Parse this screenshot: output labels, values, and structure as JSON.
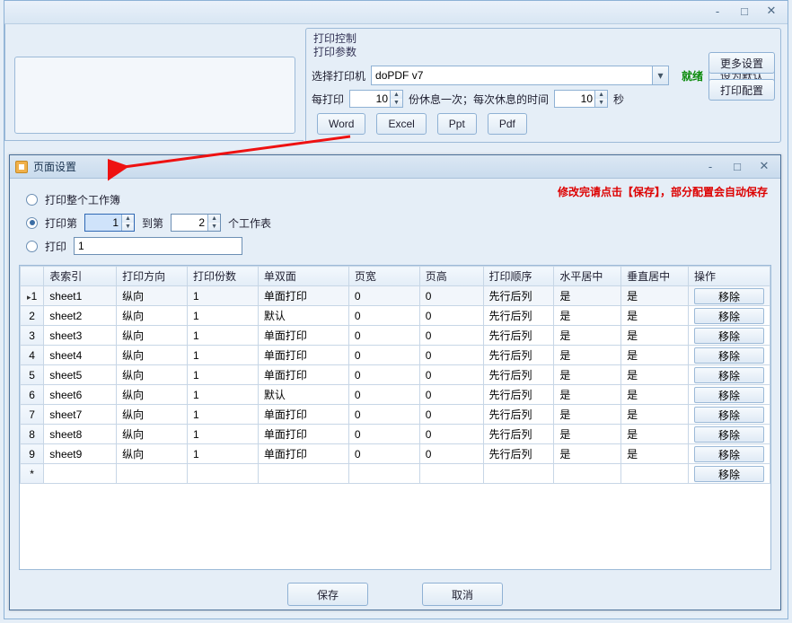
{
  "outer": {
    "groupTitle": "打印控制",
    "paramTitle": "打印参数",
    "selectPrinter": "选择打印机",
    "printerValue": "doPDF v7",
    "status": "就绪",
    "setDefault": "设为默认",
    "eachPrint": "每打印",
    "eachPrintValue": "10",
    "restOnce": "份休息一次；每次休息的时间",
    "restTimeValue": "10",
    "seconds": "秒",
    "moreSettings": "更多设置",
    "printConfig": "打印配置",
    "fmtWord": "Word",
    "fmtExcel": "Excel",
    "fmtPpt": "Ppt",
    "fmtPdf": "Pdf"
  },
  "dialog": {
    "title": "页面设置",
    "opt1": "打印整个工作簿",
    "opt2a": "打印第",
    "opt2b": "到第",
    "opt2c": "个工作表",
    "fromValue": "1",
    "toValue": "2",
    "opt3": "打印",
    "opt3Value": "1",
    "redNote": "修改完请点击【保存】，部分配置会自动保存",
    "save": "保存",
    "cancel": "取消"
  },
  "grid": {
    "headers": [
      "",
      "表索引",
      "打印方向",
      "打印份数",
      "单双面",
      "页宽",
      "页高",
      "打印顺序",
      "水平居中",
      "垂直居中",
      "操作"
    ],
    "removeLabel": "移除",
    "rows": [
      {
        "n": "1",
        "idx": "sheet1",
        "dir": "纵向",
        "copies": "1",
        "side": "单面打印",
        "w": "0",
        "h": "0",
        "order": "先行后列",
        "hc": "是",
        "vc": "是"
      },
      {
        "n": "2",
        "idx": "sheet2",
        "dir": "纵向",
        "copies": "1",
        "side": "默认",
        "w": "0",
        "h": "0",
        "order": "先行后列",
        "hc": "是",
        "vc": "是"
      },
      {
        "n": "3",
        "idx": "sheet3",
        "dir": "纵向",
        "copies": "1",
        "side": "单面打印",
        "w": "0",
        "h": "0",
        "order": "先行后列",
        "hc": "是",
        "vc": "是"
      },
      {
        "n": "4",
        "idx": "sheet4",
        "dir": "纵向",
        "copies": "1",
        "side": "单面打印",
        "w": "0",
        "h": "0",
        "order": "先行后列",
        "hc": "是",
        "vc": "是"
      },
      {
        "n": "5",
        "idx": "sheet5",
        "dir": "纵向",
        "copies": "1",
        "side": "单面打印",
        "w": "0",
        "h": "0",
        "order": "先行后列",
        "hc": "是",
        "vc": "是"
      },
      {
        "n": "6",
        "idx": "sheet6",
        "dir": "纵向",
        "copies": "1",
        "side": "默认",
        "w": "0",
        "h": "0",
        "order": "先行后列",
        "hc": "是",
        "vc": "是"
      },
      {
        "n": "7",
        "idx": "sheet7",
        "dir": "纵向",
        "copies": "1",
        "side": "单面打印",
        "w": "0",
        "h": "0",
        "order": "先行后列",
        "hc": "是",
        "vc": "是"
      },
      {
        "n": "8",
        "idx": "sheet8",
        "dir": "纵向",
        "copies": "1",
        "side": "单面打印",
        "w": "0",
        "h": "0",
        "order": "先行后列",
        "hc": "是",
        "vc": "是"
      },
      {
        "n": "9",
        "idx": "sheet9",
        "dir": "纵向",
        "copies": "1",
        "side": "单面打印",
        "w": "0",
        "h": "0",
        "order": "先行后列",
        "hc": "是",
        "vc": "是"
      }
    ]
  }
}
